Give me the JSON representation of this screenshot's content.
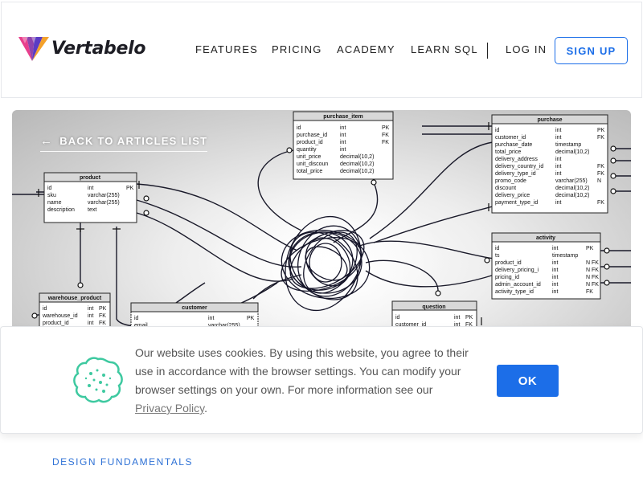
{
  "header": {
    "logo_text": "Vertabelo",
    "nav": [
      {
        "label": "FEATURES"
      },
      {
        "label": "PRICING"
      },
      {
        "label": "ACADEMY"
      },
      {
        "label": "LEARN SQL"
      }
    ],
    "login_label": "LOG IN",
    "signup_label": "SIGN UP"
  },
  "hero": {
    "back_label": "BACK TO ARTICLES LIST",
    "tables": {
      "purchase_item": {
        "title": "purchase_item",
        "rows": [
          [
            "id",
            "int",
            "PK"
          ],
          [
            "purchase_id",
            "int",
            "FK"
          ],
          [
            "product_id",
            "int",
            "FK"
          ],
          [
            "quantity",
            "int",
            ""
          ],
          [
            "unit_price",
            "decimal(10,2)",
            ""
          ],
          [
            "unit_discoun",
            "decimal(10,2)",
            ""
          ],
          [
            "total_price",
            "decimal(10,2)",
            ""
          ]
        ]
      },
      "purchase": {
        "title": "purchase",
        "rows": [
          [
            "id",
            "int",
            "PK"
          ],
          [
            "customer_id",
            "int",
            "FK"
          ],
          [
            "purchase_date",
            "timestamp",
            ""
          ],
          [
            "total_price",
            "decimal(10,2)",
            ""
          ],
          [
            "delivery_address",
            "int",
            ""
          ],
          [
            "delivery_country_id",
            "int",
            "FK"
          ],
          [
            "delivery_type_id",
            "int",
            "FK"
          ],
          [
            "promo_code",
            "varchar(255)",
            "N"
          ],
          [
            "discount",
            "decimal(10,2)",
            ""
          ],
          [
            "delivery_price",
            "decimal(10,2)",
            ""
          ],
          [
            "payment_type_id",
            "int",
            "FK"
          ]
        ]
      },
      "product": {
        "title": "product",
        "rows": [
          [
            "id",
            "int",
            "PK"
          ],
          [
            "sku",
            "varchar(255)",
            ""
          ],
          [
            "name",
            "varchar(255)",
            ""
          ],
          [
            "description",
            "text",
            ""
          ]
        ]
      },
      "activity": {
        "title": "activity",
        "rows": [
          [
            "id",
            "int",
            "PK"
          ],
          [
            "ts",
            "timestamp",
            ""
          ],
          [
            "product_id",
            "int",
            "N FK"
          ],
          [
            "delivery_pricing_i",
            "int",
            "N FK"
          ],
          [
            "pricing_id",
            "int",
            "N FK"
          ],
          [
            "admin_account_id",
            "int",
            "N FK"
          ],
          [
            "activity_type_id",
            "int",
            "FK"
          ]
        ]
      },
      "warehouse_product": {
        "title": "warehouse_product",
        "rows": [
          [
            "id",
            "int",
            "PK"
          ],
          [
            "warehouse_id",
            "int",
            "FK"
          ],
          [
            "product_id",
            "int",
            "FK"
          ]
        ]
      },
      "customer": {
        "title": "customer",
        "rows": [
          [
            "id",
            "int",
            "PK"
          ],
          [
            "email",
            "varchar(255)",
            ""
          ]
        ]
      },
      "question": {
        "title": "question",
        "rows": [
          [
            "id",
            "int",
            "PK"
          ],
          [
            "customer_id",
            "int",
            "FK"
          ]
        ]
      }
    }
  },
  "cookie": {
    "text_main": "Our website uses cookies. By using this website, you agree to their use in accordance with the browser settings. You can modify your browser settings on your own. For more information see our",
    "policy_link": "Privacy Policy",
    "period": ".",
    "ok_label": "OK"
  },
  "article": {
    "category": "DESIGN FUNDAMENTALS"
  },
  "colors": {
    "accent": "#1c6ee8",
    "cookie_icon": "#3ec9a0"
  }
}
